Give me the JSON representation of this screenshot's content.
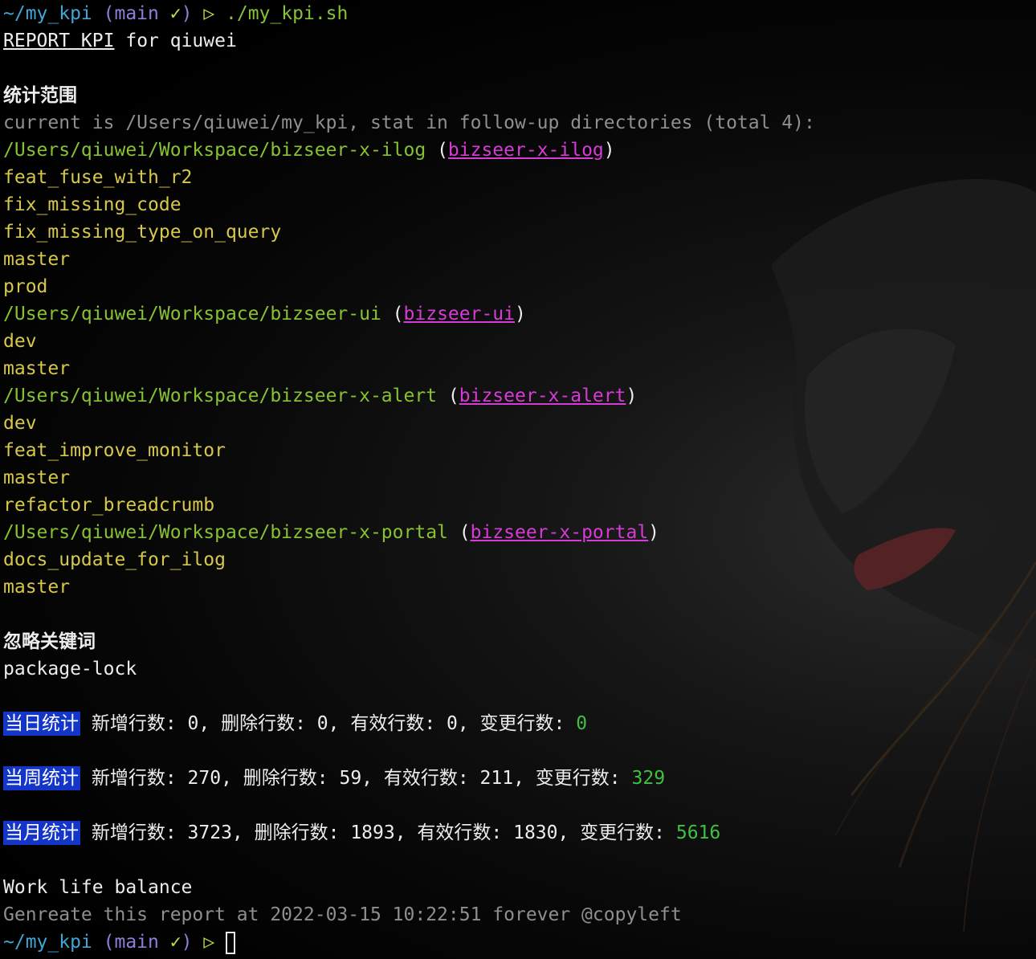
{
  "prompt": {
    "dir": "~/my_kpi",
    "branch_open": "(main",
    "check": "✓",
    "branch_close": ")",
    "arrow": "▷",
    "command": "./my_kpi.sh"
  },
  "report": {
    "title_link": "REPORT KPI",
    "title_rest": "for qiuwei"
  },
  "scope": {
    "heading": "统计范围",
    "summary": "current is /Users/qiuwei/my_kpi, stat in follow-up directories (total 4):",
    "repos": [
      {
        "path": "/Users/qiuwei/Workspace/bizseer-x-ilog",
        "name": "bizseer-x-ilog",
        "branches": [
          "feat_fuse_with_r2",
          "fix_missing_code",
          "fix_missing_type_on_query",
          "master",
          "prod"
        ]
      },
      {
        "path": "/Users/qiuwei/Workspace/bizseer-ui",
        "name": "bizseer-ui",
        "branches": [
          "dev",
          "master"
        ]
      },
      {
        "path": "/Users/qiuwei/Workspace/bizseer-x-alert",
        "name": "bizseer-x-alert",
        "branches": [
          "dev",
          "feat_improve_monitor",
          "master",
          "refactor_breadcrumb"
        ]
      },
      {
        "path": "/Users/qiuwei/Workspace/bizseer-x-portal",
        "name": "bizseer-x-portal",
        "branches": [
          "docs_update_for_ilog",
          "master"
        ]
      }
    ]
  },
  "ignore": {
    "heading": "忽略关键词",
    "keyword": "package-lock"
  },
  "stats": [
    {
      "label": "当日统计",
      "text": " 新增行数: 0, 删除行数: 0, 有效行数: 0, 变更行数: ",
      "total": "0"
    },
    {
      "label": "当周统计",
      "text": " 新增行数: 270, 删除行数: 59, 有效行数: 211, 变更行数: ",
      "total": "329"
    },
    {
      "label": "当月统计",
      "text": " 新增行数: 3723, 删除行数: 1893, 有效行数: 1830, 变更行数: ",
      "total": "5616"
    }
  ],
  "footer": {
    "line1": "Work life balance",
    "line2": "Genreate this report at 2022-03-15 10:22:51 forever @copyleft"
  },
  "colors": {
    "prompt_dir": "#3fa6d6",
    "prompt_branch": "#8f7fd8",
    "check": "#b7e34a",
    "path": "#86c232",
    "branch": "#d6c84a",
    "repo_link": "#d63bd6",
    "badge_bg": "#1436c8",
    "total": "#3ec23e"
  }
}
